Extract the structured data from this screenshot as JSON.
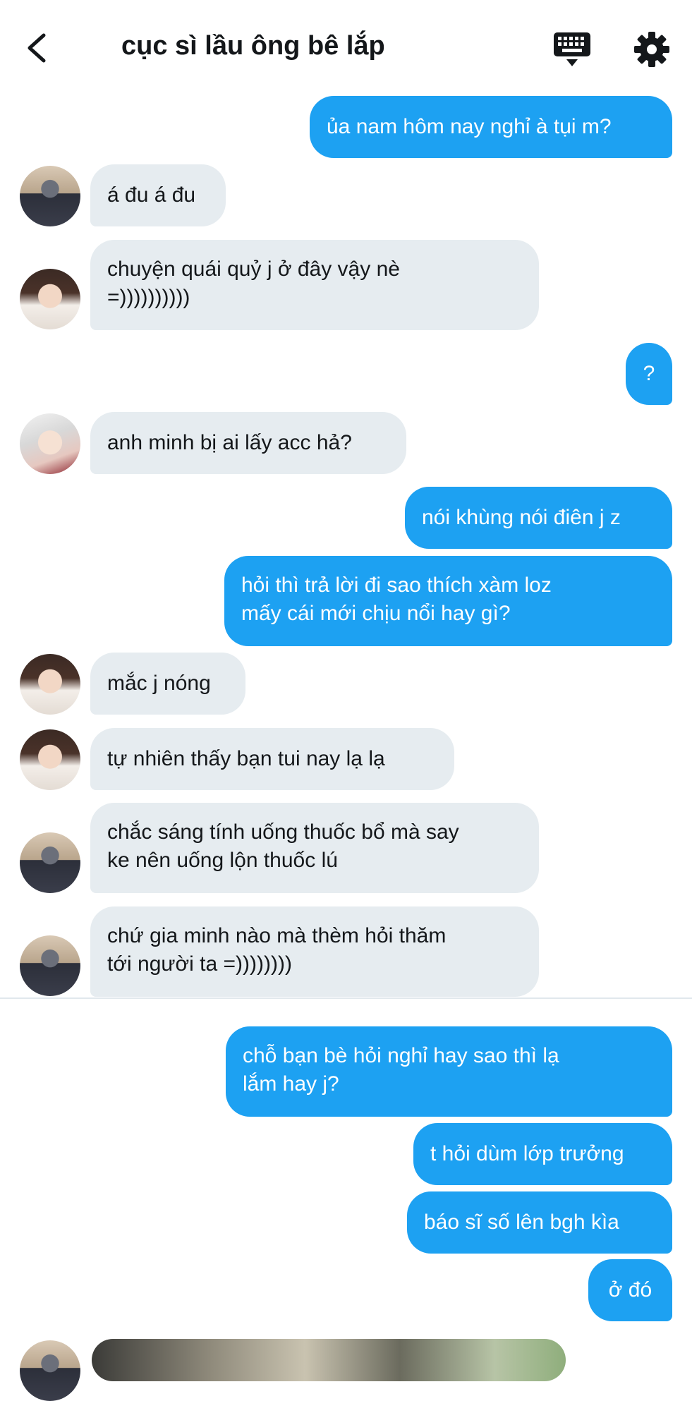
{
  "header": {
    "title": "cục sì lầu ông bê lắp",
    "back_icon": "back-chevron-icon",
    "keyboard_icon": "keyboard-icon",
    "settings_icon": "gear-icon"
  },
  "colors": {
    "outgoing_bubble": "#1da1f2",
    "incoming_bubble": "#e6ecf0",
    "text": "#14171a"
  },
  "messages": [
    {
      "dir": "out",
      "lines": [
        "ủa nam hôm nay nghỉ à tụi m?"
      ]
    },
    {
      "dir": "in",
      "lines": [
        "á đu á đu"
      ]
    },
    {
      "dir": "in",
      "lines": [
        "chuyện quái quỷ j ở đây vậy nè",
        "=))))))))))"
      ]
    },
    {
      "dir": "out",
      "lines": [
        "?"
      ]
    },
    {
      "dir": "in",
      "lines": [
        "anh minh bị ai lấy acc hả?"
      ]
    },
    {
      "dir": "out",
      "lines": [
        "nói khùng nói điên j z"
      ]
    },
    {
      "dir": "out",
      "lines": [
        "hỏi thì trả lời đi sao thích xàm loz",
        "mấy cái mới chịu nổi hay gì?"
      ]
    },
    {
      "dir": "in",
      "lines": [
        "mắc j nóng"
      ]
    },
    {
      "dir": "in",
      "lines": [
        "tự nhiên thấy bạn tui nay lạ lạ"
      ]
    },
    {
      "dir": "in",
      "lines": [
        "chắc sáng tính uống thuốc bổ mà say",
        "ke nên uống lộn thuốc lú"
      ]
    },
    {
      "dir": "in",
      "lines": [
        "chứ gia minh nào mà thèm hỏi thăm",
        "tới người ta =))))))))"
      ]
    },
    {
      "dir": "out",
      "lines": [
        "chỗ bạn bè hỏi nghỉ hay sao thì lạ",
        "lắm hay j?"
      ]
    },
    {
      "dir": "out",
      "lines": [
        "t hỏi dùm lớp trưởng"
      ]
    },
    {
      "dir": "out",
      "lines": [
        "báo sĩ số lên bgh kìa"
      ]
    },
    {
      "dir": "out",
      "lines": [
        "ở đó"
      ]
    }
  ]
}
